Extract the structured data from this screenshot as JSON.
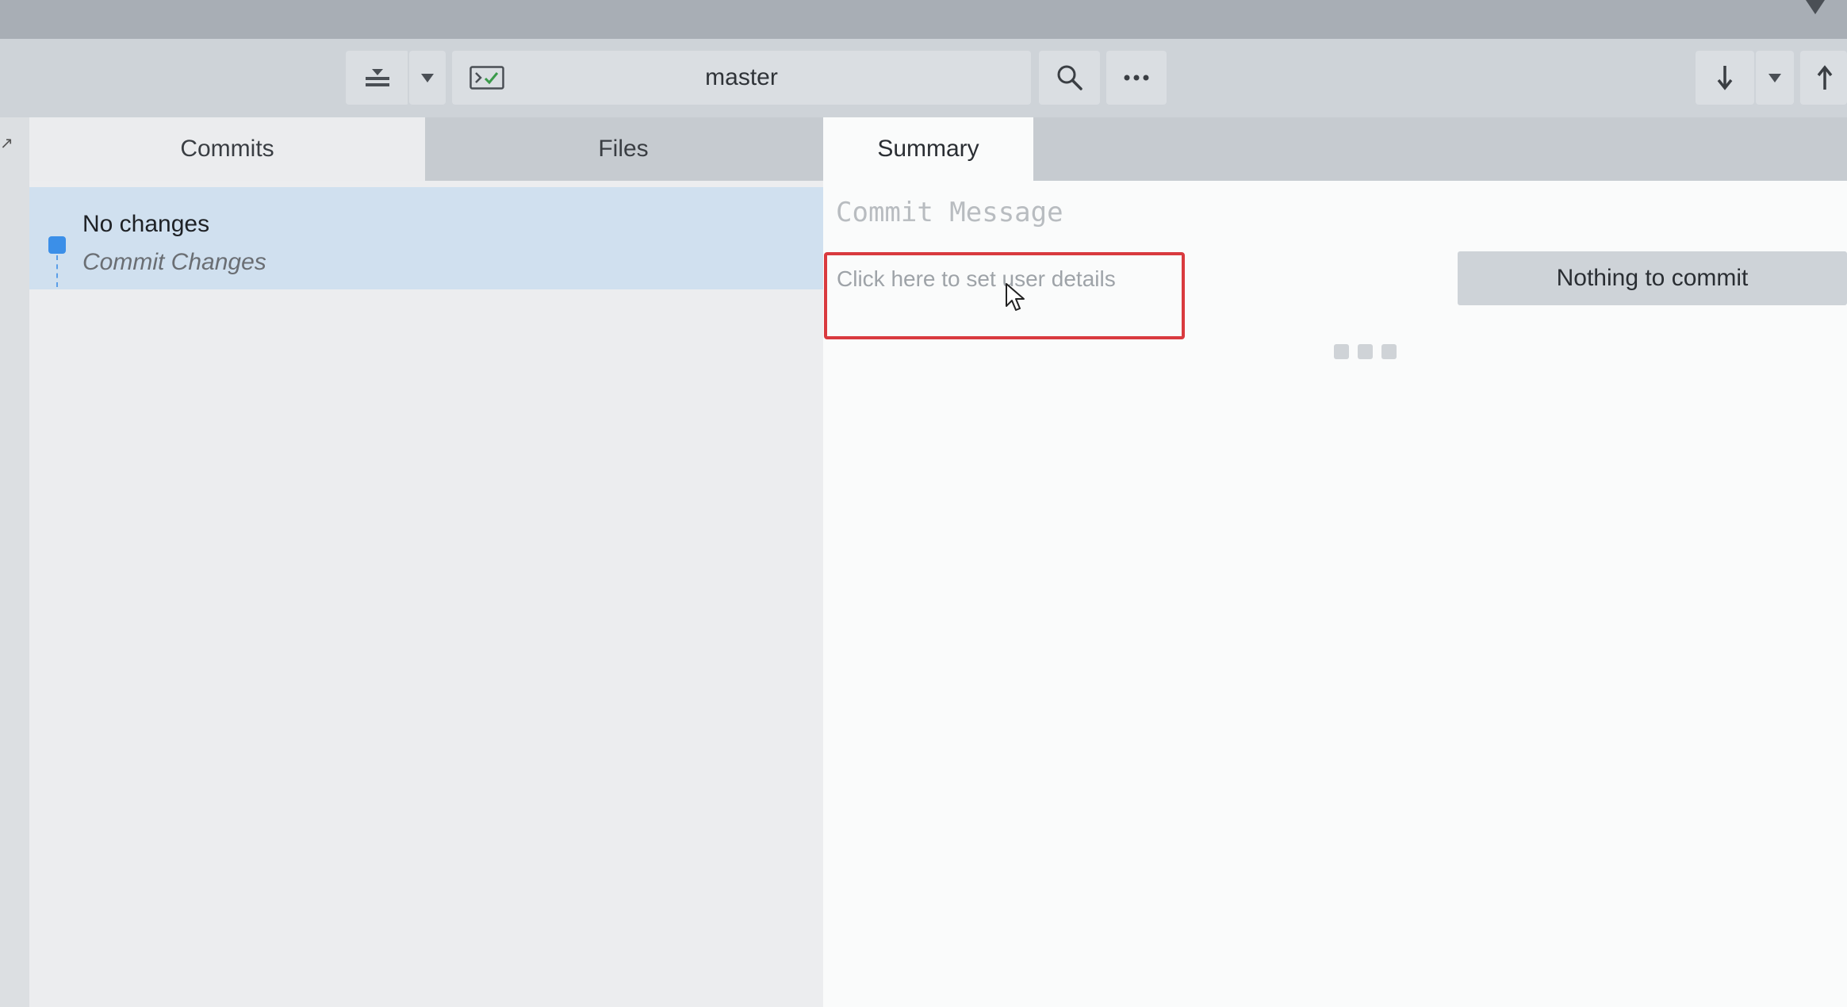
{
  "toolbar": {
    "stash_icon": "stash-icon",
    "branch": "master",
    "search_icon": "search-icon",
    "more_icon": "more-icon",
    "pull_icon": "arrow-down-icon",
    "push_icon": "arrow-up-icon"
  },
  "tabs": [
    {
      "label": "Commits"
    },
    {
      "label": "Files"
    },
    {
      "label": "Summary"
    }
  ],
  "commits": [
    {
      "title": "No changes",
      "subtitle": "Commit Changes"
    }
  ],
  "summary": {
    "commit_message_placeholder": "Commit Message",
    "user_details_prompt": "Click here to set user details",
    "commit_button_label": "Nothing to commit"
  },
  "colors": {
    "accent": "#3b8fe8",
    "highlight_border": "#d93a3f",
    "selected_row": "#d0e0ef"
  }
}
